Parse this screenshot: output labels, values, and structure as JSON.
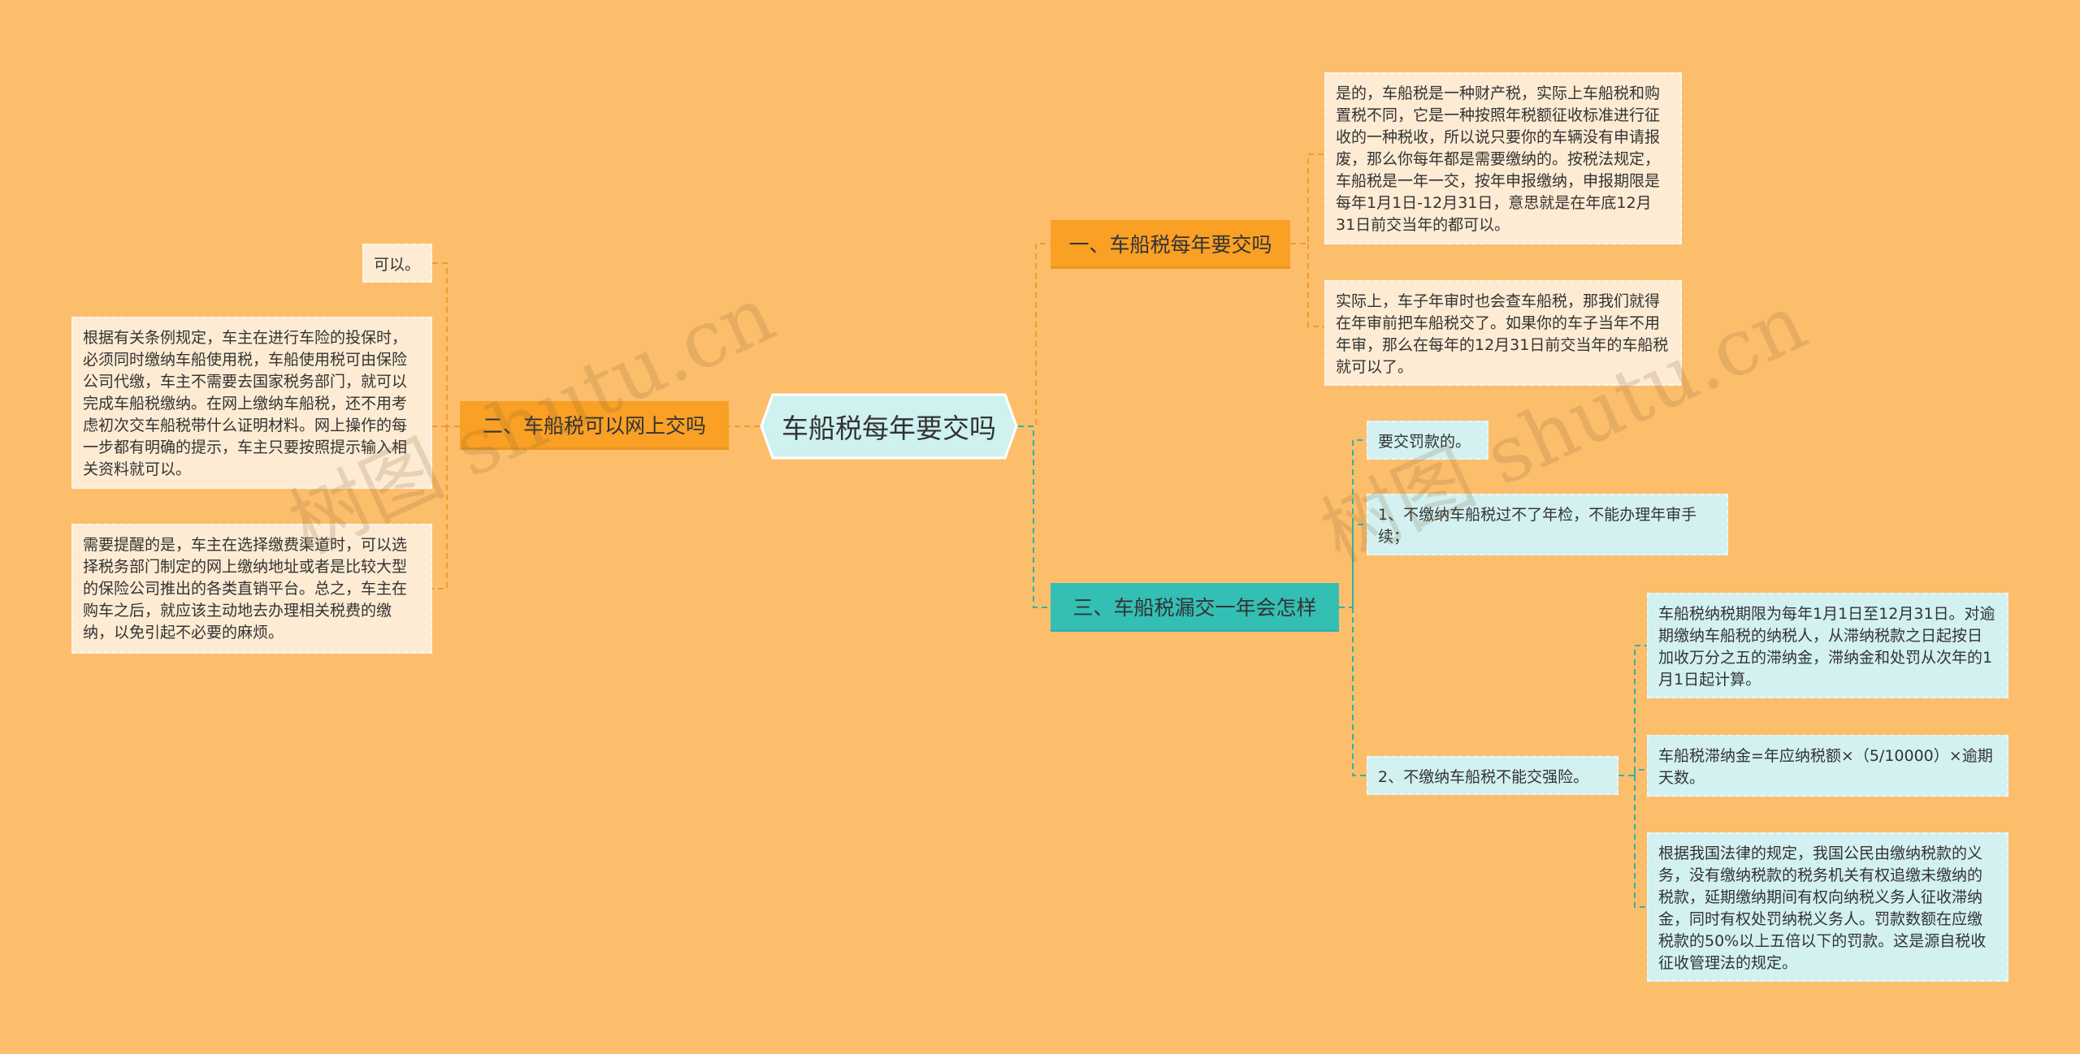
{
  "watermark": "树图 shutu.cn",
  "root": {
    "title": "车船税每年要交吗"
  },
  "branches": {
    "b1": {
      "title": "一、车船税每年要交吗",
      "leaves": [
        "是的，车船税是一种财产税，实际上车船税和购置税不同，它是一种按照年税额征收标准进行征收的一种税收，所以说只要你的车辆没有申请报废，那么你每年都是需要缴纳的。按税法规定，车船税是一年一交，按年申报缴纳，申报期限是每年1月1日-12月31日，意思就是在年底12月31日前交当年的都可以。",
        "实际上，车子年审时也会查车船税，那我们就得在年审前把车船税交了。如果你的车子当年不用年审，那么在每年的12月31日前交当年的车船税就可以了。"
      ]
    },
    "b2": {
      "title": "二、车船税可以网上交吗",
      "leaves": [
        "可以。",
        "根据有关条例规定，车主在进行车险的投保时，必须同时缴纳车船使用税，车船使用税可由保险公司代缴，车主不需要去国家税务部门，就可以完成车船税缴纳。在网上缴纳车船税，还不用考虑初次交车船税带什么证明材料。网上操作的每一步都有明确的提示，车主只要按照提示输入相关资料就可以。",
        "需要提醒的是，车主在选择缴费渠道时，可以选择税务部门制定的网上缴纳地址或者是比较大型的保险公司推出的各类直销平台。总之，车主在购车之后，就应该主动地去办理相关税费的缴纳，以免引起不必要的麻烦。"
      ]
    },
    "b3": {
      "title": "三、车船税漏交一年会怎样",
      "leaves": [
        "要交罚款的。",
        "1、不缴纳车船税过不了年检，不能办理年审手续；",
        "2、不缴纳车船税不能交强险。"
      ],
      "subleaves": [
        "车船税纳税期限为每年1月1日至12月31日。对逾期缴纳车船税的纳税人，从滞纳税款之日起按日加收万分之五的滞纳金，滞纳金和处罚从次年的1月1日起计算。",
        "车船税滞纳金=年应纳税额×（5/10000）×逾期天数。",
        "根据我国法律的规定，我国公民由缴纳税款的义务，没有缴纳税款的税务机关有权追缴未缴纳的税款，延期缴纳期间有权向纳税义务人征收滞纳金，同时有权处罚纳税义务人。罚款数额在应缴税款的50%以上五倍以下的罚款。这是源自税收征收管理法的规定。"
      ]
    }
  }
}
